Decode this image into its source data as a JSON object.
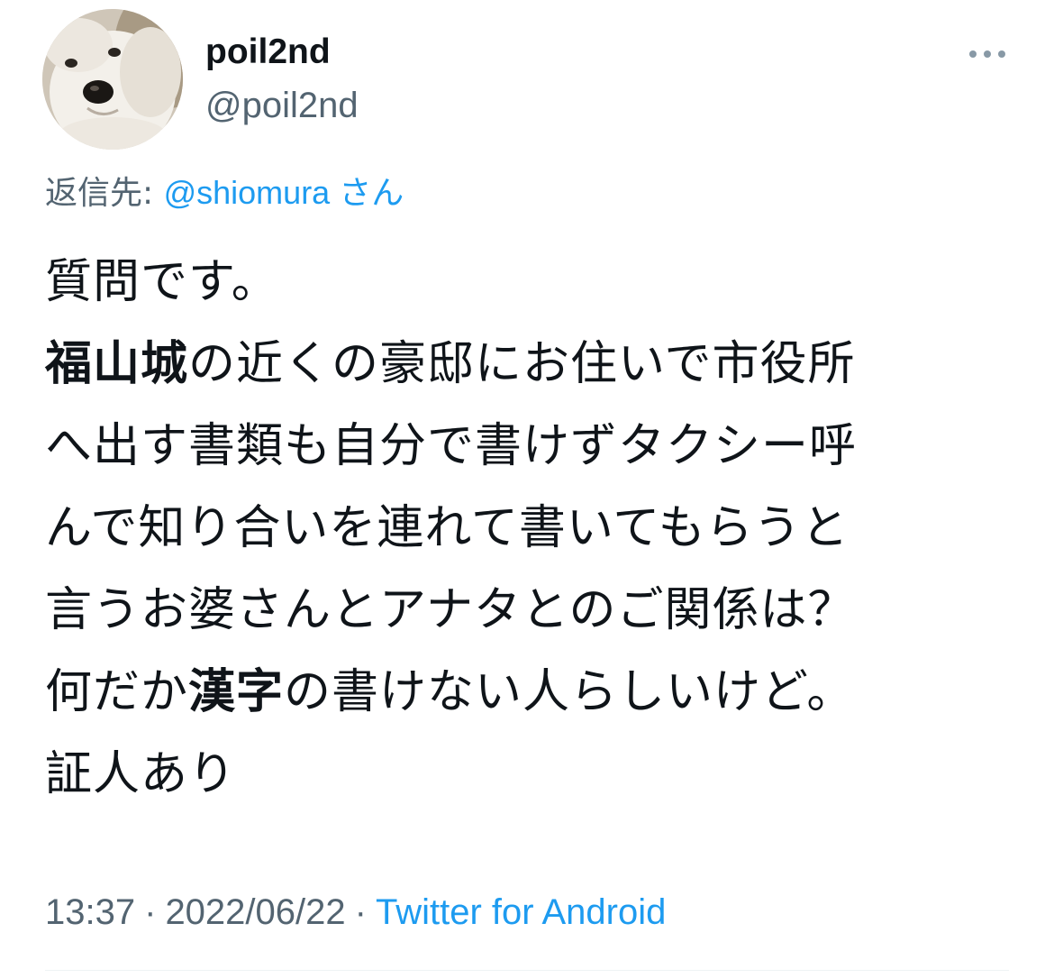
{
  "user": {
    "display_name": "poil2nd",
    "handle": "@poil2nd",
    "avatar_icon": "dog-avatar"
  },
  "reply": {
    "prefix": "返信先:",
    "mention": "@shiomura",
    "suffix": "さん"
  },
  "body": {
    "line1": "質問です。",
    "line2_bold": "福山城",
    "line2_rest": "の近くの豪邸にお住いで市役所",
    "line3": "へ出す書類も自分で書けずタクシー呼",
    "line4": "んで知り合いを連れて書いてもらうと",
    "line5": "言うお婆さんとアナタとのご関係は？",
    "line6_start": "何だか",
    "line6_bold": "漢字",
    "line6_rest": "の書けない人らしいけど。",
    "line7": "証人あり"
  },
  "meta": {
    "time": "13:37",
    "date": "2022/06/22",
    "separator": "·",
    "source": "Twitter for Android"
  },
  "colors": {
    "text": "#0f1419",
    "secondary": "#536471",
    "link": "#1d9bf0"
  }
}
